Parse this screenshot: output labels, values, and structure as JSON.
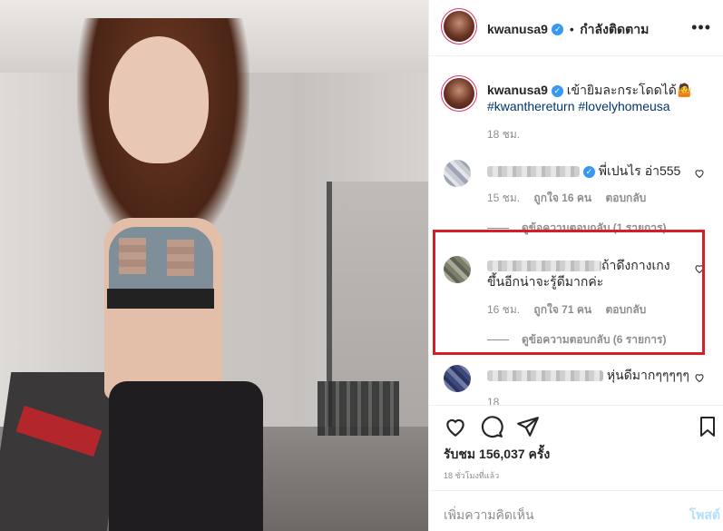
{
  "header": {
    "username": "kwanusa9",
    "separator": "•",
    "follow_status": "กำลังติดตาม",
    "more_icon": "more-horizontal-icon"
  },
  "caption": {
    "username": "kwanusa9",
    "text": "เข้ายิมละกระโดดได้🤷",
    "hashtags": "#kwanthereturn #lovelyhomeusa",
    "time": "18 ชม."
  },
  "comments": [
    {
      "text": "พี่เปนไร อ่า555",
      "time": "15 ชม.",
      "likes": "ถูกใจ 16 คน",
      "reply_label": "ตอบกลับ",
      "view_replies": "ดูข้อความตอบกลับ (1 รายการ)"
    },
    {
      "text_line1": "ถ้าดึงกางเกง",
      "text_line2": "ขึ้นอีกน่าจะรู้ดีมากค่ะ",
      "time": "16 ชม.",
      "likes": "ถูกใจ 71 คน",
      "reply_label": "ตอบกลับ",
      "view_replies": "ดูข้อความตอบกลับ (6 รายการ)"
    },
    {
      "text": "หุ่นดีมากๆๆๆๆๆ",
      "time": "18"
    }
  ],
  "actions": {
    "views_label": "รับชม",
    "views_count": "156,037",
    "views_suffix": "ครั้ง",
    "timestamp": "18 ชั่วโมงที่แล้ว"
  },
  "add_comment": {
    "placeholder": "เพิ่มความคิดเห็น",
    "post_label": "โพสต์"
  },
  "colors": {
    "verified_blue": "#3897f0",
    "highlight_red": "#d31f25",
    "post_button_disabled": "#b2dffc"
  }
}
